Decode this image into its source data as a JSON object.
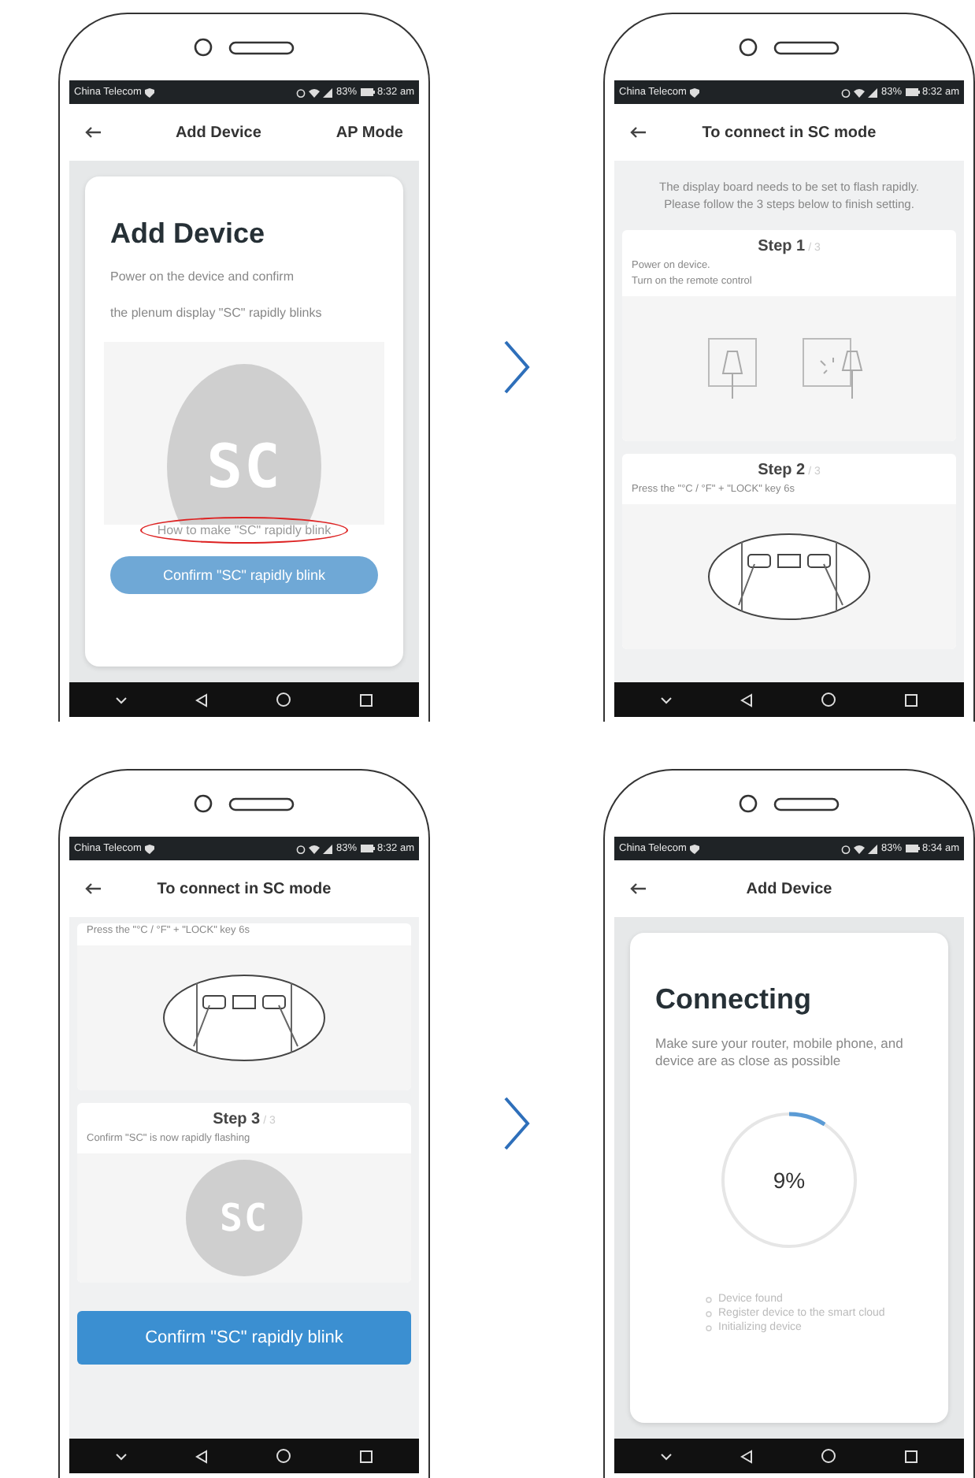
{
  "phones": [
    {
      "status_bar": {
        "carrier": "China Telecom",
        "battery": "83%",
        "time": "8:32 am"
      },
      "header": {
        "title": "Add Device",
        "action": "AP Mode"
      },
      "screen": {
        "kind": "intro",
        "title": "Add Device",
        "lines": [
          "Power on the device and confirm",
          "the plenum display \"SC\" rapidly blinks"
        ],
        "display": "SC",
        "help_link": "How to make \"SC\" rapidly blink",
        "button": "Confirm \"SC\" rapidly blink"
      }
    },
    {
      "status_bar": {
        "carrier": "China Telecom",
        "battery": "83%",
        "time": "8:32 am"
      },
      "header": {
        "title": "To connect in SC mode"
      },
      "screen": {
        "kind": "steps",
        "intro": "The display board needs to be set to flash rapidly. Please follow the 3 steps below to finish setting.",
        "steps": [
          {
            "title": "Step 1",
            "total": "/ 3",
            "lines": [
              "Power on device.",
              "Turn on the remote control"
            ],
            "kind": "plugs"
          },
          {
            "title": "Step 2",
            "total": "/ 3",
            "lines": [
              "Press the \"°C / °F\" + \"LOCK\" key 6s"
            ],
            "kind": "keypad"
          }
        ]
      }
    },
    {
      "status_bar": {
        "carrier": "China Telecom",
        "battery": "83%",
        "time": "8:32 am"
      },
      "header": {
        "title": "To connect in SC mode"
      },
      "screen": {
        "kind": "steps",
        "steps": [
          {
            "lines": [
              "Press the \"°C / °F\" + \"LOCK\" key 6s"
            ],
            "kind": "keypad"
          },
          {
            "title": "Step 3",
            "total": "/ 3",
            "lines": [
              "Confirm \"SC\" is now rapidly flashing"
            ],
            "kind": "display",
            "display": "SC"
          }
        ],
        "button": "Confirm \"SC\" rapidly blink"
      }
    },
    {
      "status_bar": {
        "carrier": "China Telecom",
        "battery": "83%",
        "time": "8:34 am"
      },
      "header": {
        "title": "Add Device"
      },
      "screen": {
        "kind": "connecting",
        "title": "Connecting",
        "text": "Make sure your router, mobile phone, and device are as close as possible",
        "progress": {
          "level": 0.09,
          "reading": "9%"
        },
        "checklist": [
          "Device found",
          "Register device to the smart cloud",
          "Initializing device"
        ]
      }
    }
  ]
}
